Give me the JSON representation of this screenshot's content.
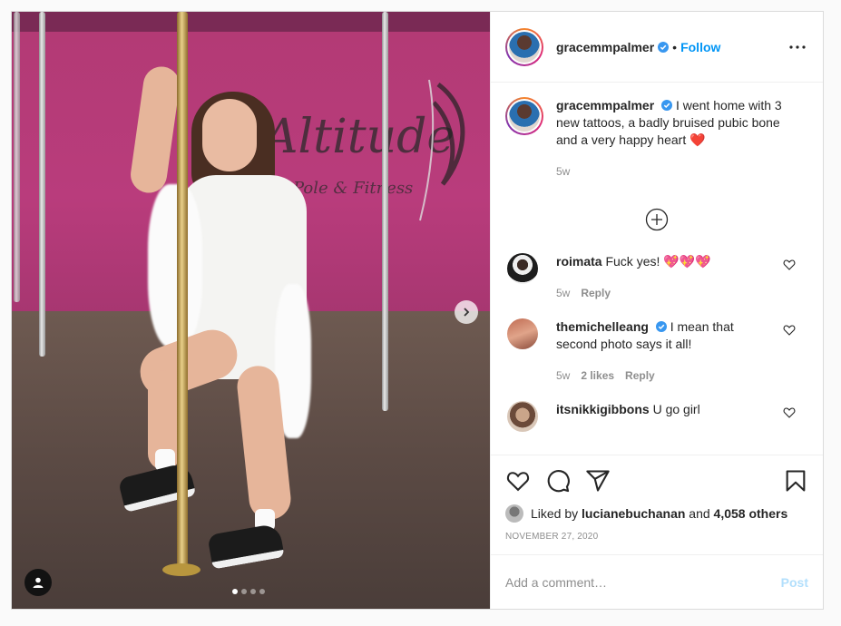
{
  "header": {
    "username": "gracemmpalmer",
    "separator": "•",
    "follow_label": "Follow"
  },
  "caption": {
    "username": "gracemmpalmer",
    "text": "I went home with 3 new tattoos, a badly bruised pubic bone and a very happy heart",
    "emoji": "❤️",
    "age": "5w"
  },
  "comments": [
    {
      "username": "roimata",
      "text": "Fuck yes!",
      "emoji": "💖💖💖",
      "age": "5w",
      "likes": "",
      "reply": "Reply"
    },
    {
      "username": "themichelleang",
      "text": "I mean that second photo says it all!",
      "age": "5w",
      "likes": "2 likes",
      "reply": "Reply"
    },
    {
      "username": "itsnikkigibbons",
      "text": "U go girl"
    }
  ],
  "likes": {
    "prefix": "Liked by",
    "liker": "lucianebuchanan",
    "and": "and",
    "others": "4,058 others"
  },
  "post_date": "NOVEMBER 27, 2020",
  "comment_box": {
    "placeholder": "Add a comment…",
    "post_label": "Post"
  },
  "sign_text": {
    "main": "Altitude",
    "sub": "Pole & Fitness"
  },
  "carousel": {
    "total": 4,
    "active": 1
  },
  "colors": {
    "accent": "#0095f6",
    "post_disabled": "#b2dffc",
    "verified": "#3897f0"
  }
}
